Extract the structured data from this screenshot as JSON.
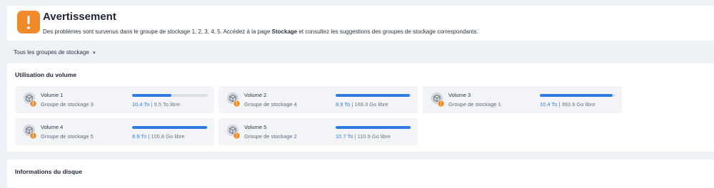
{
  "warning": {
    "title": "Avertissement",
    "message_prefix": "Des problèmes sont survenus dans le groupe de stockage 1, 2, 3, 4, 5. Accédez à la page ",
    "message_link": "Stockage",
    "message_suffix": " et consultez les suggestions des groupes de stockage correspondants.",
    "icon": "exclamation-icon",
    "color": "#f08a2c"
  },
  "filter": {
    "label": "Tous les groupes de stockage",
    "icon": "caret-down-icon"
  },
  "volume_section": {
    "title": "Utilisation du volume",
    "volumes": [
      {
        "name": "Volume 1",
        "pool": "Groupe de stockage 3",
        "used": "10.4 To",
        "free": "9.5 To libre",
        "usage_fraction": 0.52
      },
      {
        "name": "Volume 2",
        "pool": "Groupe de stockage 4",
        "used": "8.9 To",
        "free": "169.3 Go libre",
        "usage_fraction": 0.98
      },
      {
        "name": "Volume 3",
        "pool": "Groupe de stockage 1",
        "used": "10.4 To",
        "free": "393.6 Go libre",
        "usage_fraction": 0.96
      },
      {
        "name": "Volume 4",
        "pool": "Groupe de stockage 5",
        "used": "8.9 To",
        "free": "105.8 Go libre",
        "usage_fraction": 0.99
      },
      {
        "name": "Volume 5",
        "pool": "Groupe de stockage 2",
        "used": "10.7 To",
        "free": "110.9 Go libre",
        "usage_fraction": 0.99
      }
    ]
  },
  "disk_section": {
    "title": "Informations du disque"
  },
  "colors": {
    "accent": "#2d7be3",
    "warning": "#f08a2c",
    "background": "#eef1f6"
  }
}
